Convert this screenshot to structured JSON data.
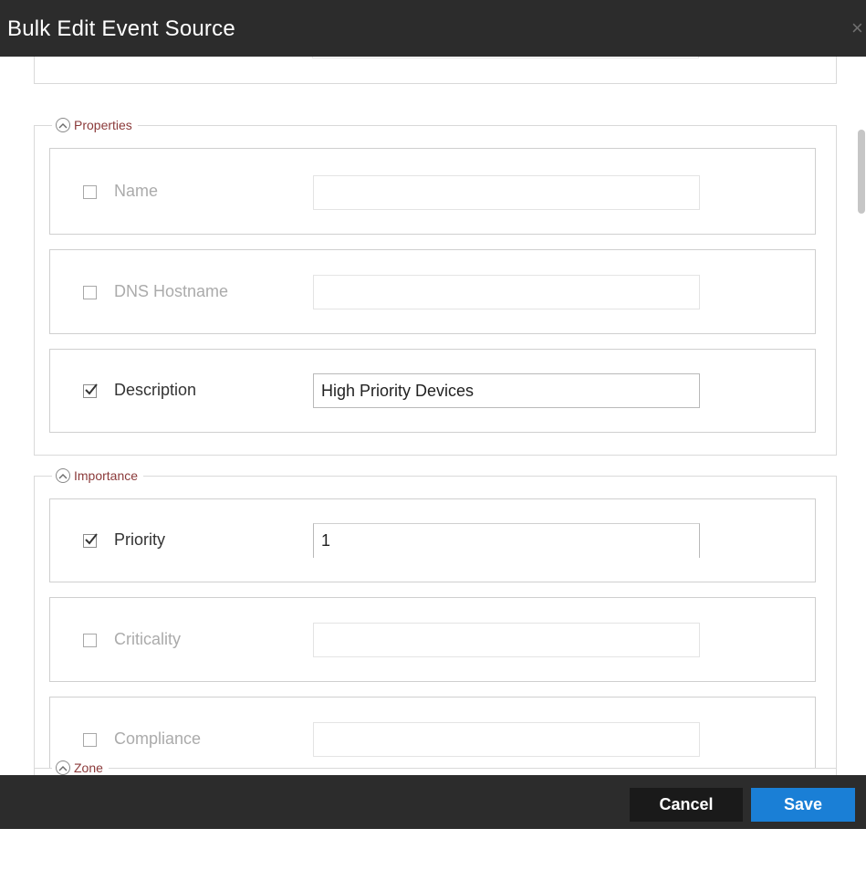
{
  "dialog": {
    "title": "Bulk Edit Event Source",
    "close_glyph": "×"
  },
  "sections": {
    "properties": {
      "label": "Properties",
      "icon": "chevron-up-icon"
    },
    "importance": {
      "label": "Importance",
      "icon": "chevron-up-icon"
    },
    "zone": {
      "label": "Zone",
      "icon": "chevron-up-icon"
    }
  },
  "fields": {
    "name": {
      "label": "Name",
      "checked": false,
      "value": ""
    },
    "dns_hostname": {
      "label": "DNS Hostname",
      "checked": false,
      "value": ""
    },
    "description": {
      "label": "Description",
      "checked": true,
      "value": "High Priority Devices"
    },
    "priority": {
      "label": "Priority",
      "checked": true,
      "value": "1"
    },
    "criticality": {
      "label": "Criticality",
      "checked": false,
      "value": ""
    },
    "compliance": {
      "label": "Compliance",
      "checked": false,
      "value": ""
    }
  },
  "footer": {
    "cancel_label": "Cancel",
    "save_label": "Save"
  },
  "colors": {
    "titlebar": "#2c2c2c",
    "section_label": "#8b3a3a",
    "save_button": "#1a7fd6",
    "cancel_button": "#1a1a1a"
  }
}
